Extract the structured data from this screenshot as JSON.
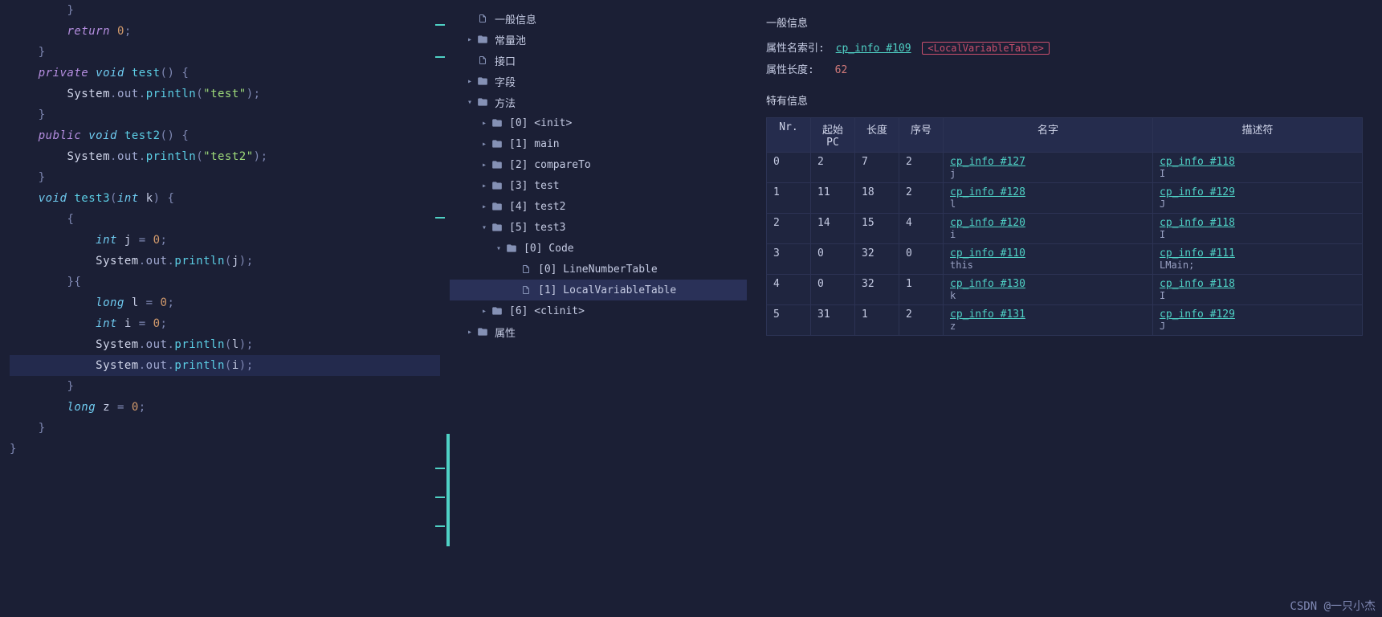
{
  "code": [
    {
      "indent": 2,
      "tokens": [
        {
          "t": "}",
          "c": "punct"
        }
      ]
    },
    {
      "indent": 2,
      "tokens": [
        {
          "t": "return ",
          "c": "kw-ret"
        },
        {
          "t": "0",
          "c": "num"
        },
        {
          "t": ";",
          "c": "punct"
        }
      ]
    },
    {
      "indent": 1,
      "tokens": [
        {
          "t": "}",
          "c": "punct"
        }
      ]
    },
    {
      "indent": 0,
      "tokens": []
    },
    {
      "indent": 1,
      "tokens": [
        {
          "t": "private ",
          "c": "kw"
        },
        {
          "t": "void ",
          "c": "type"
        },
        {
          "t": "test",
          "c": "fn"
        },
        {
          "t": "() {",
          "c": "punct"
        }
      ]
    },
    {
      "indent": 2,
      "tokens": [
        {
          "t": "System",
          "c": "obj"
        },
        {
          "t": ".",
          "c": "punct"
        },
        {
          "t": "out",
          "c": "prop"
        },
        {
          "t": ".",
          "c": "punct"
        },
        {
          "t": "println",
          "c": "fn"
        },
        {
          "t": "(",
          "c": "punct"
        },
        {
          "t": "\"test\"",
          "c": "str"
        },
        {
          "t": ");",
          "c": "punct"
        }
      ]
    },
    {
      "indent": 1,
      "tokens": [
        {
          "t": "}",
          "c": "punct"
        }
      ]
    },
    {
      "indent": 0,
      "tokens": []
    },
    {
      "indent": 1,
      "tokens": [
        {
          "t": "public ",
          "c": "kw"
        },
        {
          "t": "void ",
          "c": "type"
        },
        {
          "t": "test2",
          "c": "fn"
        },
        {
          "t": "() {",
          "c": "punct"
        }
      ]
    },
    {
      "indent": 2,
      "tokens": [
        {
          "t": "System",
          "c": "obj"
        },
        {
          "t": ".",
          "c": "punct"
        },
        {
          "t": "out",
          "c": "prop"
        },
        {
          "t": ".",
          "c": "punct"
        },
        {
          "t": "println",
          "c": "fn"
        },
        {
          "t": "(",
          "c": "punct"
        },
        {
          "t": "\"test2\"",
          "c": "str"
        },
        {
          "t": ");",
          "c": "punct"
        }
      ]
    },
    {
      "indent": 1,
      "tokens": [
        {
          "t": "}",
          "c": "punct"
        }
      ]
    },
    {
      "indent": 1,
      "tokens": [
        {
          "t": "void ",
          "c": "type"
        },
        {
          "t": "test3",
          "c": "fn"
        },
        {
          "t": "(",
          "c": "punct"
        },
        {
          "t": "int ",
          "c": "type"
        },
        {
          "t": "k",
          "c": "ident"
        },
        {
          "t": ") {",
          "c": "punct"
        }
      ]
    },
    {
      "indent": 2,
      "tokens": [
        {
          "t": "{",
          "c": "punct"
        }
      ]
    },
    {
      "indent": 3,
      "tokens": [
        {
          "t": "int ",
          "c": "type"
        },
        {
          "t": "j ",
          "c": "ident"
        },
        {
          "t": "= ",
          "c": "punct"
        },
        {
          "t": "0",
          "c": "num"
        },
        {
          "t": ";",
          "c": "punct"
        }
      ]
    },
    {
      "indent": 3,
      "tokens": [
        {
          "t": "System",
          "c": "obj"
        },
        {
          "t": ".",
          "c": "punct"
        },
        {
          "t": "out",
          "c": "prop"
        },
        {
          "t": ".",
          "c": "punct"
        },
        {
          "t": "println",
          "c": "fn"
        },
        {
          "t": "(",
          "c": "punct"
        },
        {
          "t": "j",
          "c": "ident"
        },
        {
          "t": ");",
          "c": "punct"
        }
      ]
    },
    {
      "indent": 2,
      "tokens": [
        {
          "t": "}{",
          "c": "punct"
        }
      ]
    },
    {
      "indent": 3,
      "tokens": [
        {
          "t": "long ",
          "c": "type"
        },
        {
          "t": "l ",
          "c": "ident"
        },
        {
          "t": "= ",
          "c": "punct"
        },
        {
          "t": "0",
          "c": "num"
        },
        {
          "t": ";",
          "c": "punct"
        }
      ]
    },
    {
      "indent": 3,
      "tokens": [
        {
          "t": "int ",
          "c": "type"
        },
        {
          "t": "i ",
          "c": "ident"
        },
        {
          "t": "= ",
          "c": "punct"
        },
        {
          "t": "0",
          "c": "num"
        },
        {
          "t": ";",
          "c": "punct"
        }
      ]
    },
    {
      "indent": 3,
      "tokens": [
        {
          "t": "System",
          "c": "obj"
        },
        {
          "t": ".",
          "c": "punct"
        },
        {
          "t": "out",
          "c": "prop"
        },
        {
          "t": ".",
          "c": "punct"
        },
        {
          "t": "println",
          "c": "fn"
        },
        {
          "t": "(",
          "c": "punct"
        },
        {
          "t": "l",
          "c": "ident"
        },
        {
          "t": ");",
          "c": "punct"
        }
      ]
    },
    {
      "indent": 3,
      "hl": true,
      "tokens": [
        {
          "t": "System",
          "c": "obj"
        },
        {
          "t": ".",
          "c": "punct"
        },
        {
          "t": "out",
          "c": "prop"
        },
        {
          "t": ".",
          "c": "punct"
        },
        {
          "t": "println",
          "c": "fn"
        },
        {
          "t": "(",
          "c": "punct"
        },
        {
          "t": "i",
          "c": "ident"
        },
        {
          "t": ");",
          "c": "punct"
        }
      ]
    },
    {
      "indent": 2,
      "tokens": [
        {
          "t": "}",
          "c": "punct"
        }
      ]
    },
    {
      "indent": 2,
      "tokens": [
        {
          "t": "long ",
          "c": "type"
        },
        {
          "t": "z ",
          "c": "ident"
        },
        {
          "t": "= ",
          "c": "punct"
        },
        {
          "t": "0",
          "c": "num"
        },
        {
          "t": ";",
          "c": "punct"
        }
      ]
    },
    {
      "indent": 1,
      "tokens": [
        {
          "t": "}",
          "c": "punct"
        }
      ]
    },
    {
      "indent": 0,
      "tokens": [
        {
          "t": "}",
          "c": "punct"
        }
      ]
    }
  ],
  "tree": [
    {
      "indent": 1,
      "chev": "",
      "icon": "file",
      "label": "一般信息"
    },
    {
      "indent": 1,
      "chev": "right",
      "icon": "folder",
      "label": "常量池"
    },
    {
      "indent": 1,
      "chev": "",
      "icon": "file",
      "label": "接口"
    },
    {
      "indent": 1,
      "chev": "right",
      "icon": "folder",
      "label": "字段"
    },
    {
      "indent": 1,
      "chev": "down",
      "icon": "folder",
      "label": "方法"
    },
    {
      "indent": 2,
      "chev": "right",
      "icon": "folder",
      "label": "[0] <init>"
    },
    {
      "indent": 2,
      "chev": "right",
      "icon": "folder",
      "label": "[1] main"
    },
    {
      "indent": 2,
      "chev": "right",
      "icon": "folder",
      "label": "[2] compareTo"
    },
    {
      "indent": 2,
      "chev": "right",
      "icon": "folder",
      "label": "[3] test"
    },
    {
      "indent": 2,
      "chev": "right",
      "icon": "folder",
      "label": "[4] test2"
    },
    {
      "indent": 2,
      "chev": "down",
      "icon": "folder",
      "label": "[5] test3"
    },
    {
      "indent": 3,
      "chev": "down",
      "icon": "folder",
      "label": "[0] Code"
    },
    {
      "indent": 4,
      "chev": "",
      "icon": "file",
      "label": "[0] LineNumberTable"
    },
    {
      "indent": 4,
      "chev": "",
      "icon": "file",
      "label": "[1] LocalVariableTable",
      "selected": true
    },
    {
      "indent": 2,
      "chev": "right",
      "icon": "folder",
      "label": "[6] <clinit>"
    },
    {
      "indent": 1,
      "chev": "right",
      "icon": "folder",
      "label": "属性"
    }
  ],
  "detail": {
    "section_general": "一般信息",
    "attr_name_index_key": "属性名索引:",
    "attr_name_index_link": "cp_info #109",
    "attr_name_tag": "<LocalVariableTable>",
    "attr_len_key": "属性长度:",
    "attr_len_val": "62",
    "section_specific": "特有信息",
    "headers": [
      "Nr.",
      "起始PC",
      "长度",
      "序号",
      "名字",
      "描述符"
    ],
    "rows": [
      {
        "nr": "0",
        "start": "2",
        "len": "7",
        "idx": "2",
        "name_link": "cp_info #127",
        "name_sub": "j",
        "desc_link": "cp_info #118",
        "desc_sub": "I"
      },
      {
        "nr": "1",
        "start": "11",
        "len": "18",
        "idx": "2",
        "name_link": "cp_info #128",
        "name_sub": "l",
        "desc_link": "cp_info #129",
        "desc_sub": "J"
      },
      {
        "nr": "2",
        "start": "14",
        "len": "15",
        "idx": "4",
        "name_link": "cp_info #120",
        "name_sub": "i",
        "desc_link": "cp_info #118",
        "desc_sub": "I"
      },
      {
        "nr": "3",
        "start": "0",
        "len": "32",
        "idx": "0",
        "name_link": "cp_info #110",
        "name_sub": "this",
        "desc_link": "cp_info #111",
        "desc_sub": "LMain;"
      },
      {
        "nr": "4",
        "start": "0",
        "len": "32",
        "idx": "1",
        "name_link": "cp_info #130",
        "name_sub": "k",
        "desc_link": "cp_info #118",
        "desc_sub": "I"
      },
      {
        "nr": "5",
        "start": "31",
        "len": "1",
        "idx": "2",
        "name_link": "cp_info #131",
        "name_sub": "z",
        "desc_link": "cp_info #129",
        "desc_sub": "J"
      }
    ]
  },
  "watermark": "CSDN @一只小杰"
}
